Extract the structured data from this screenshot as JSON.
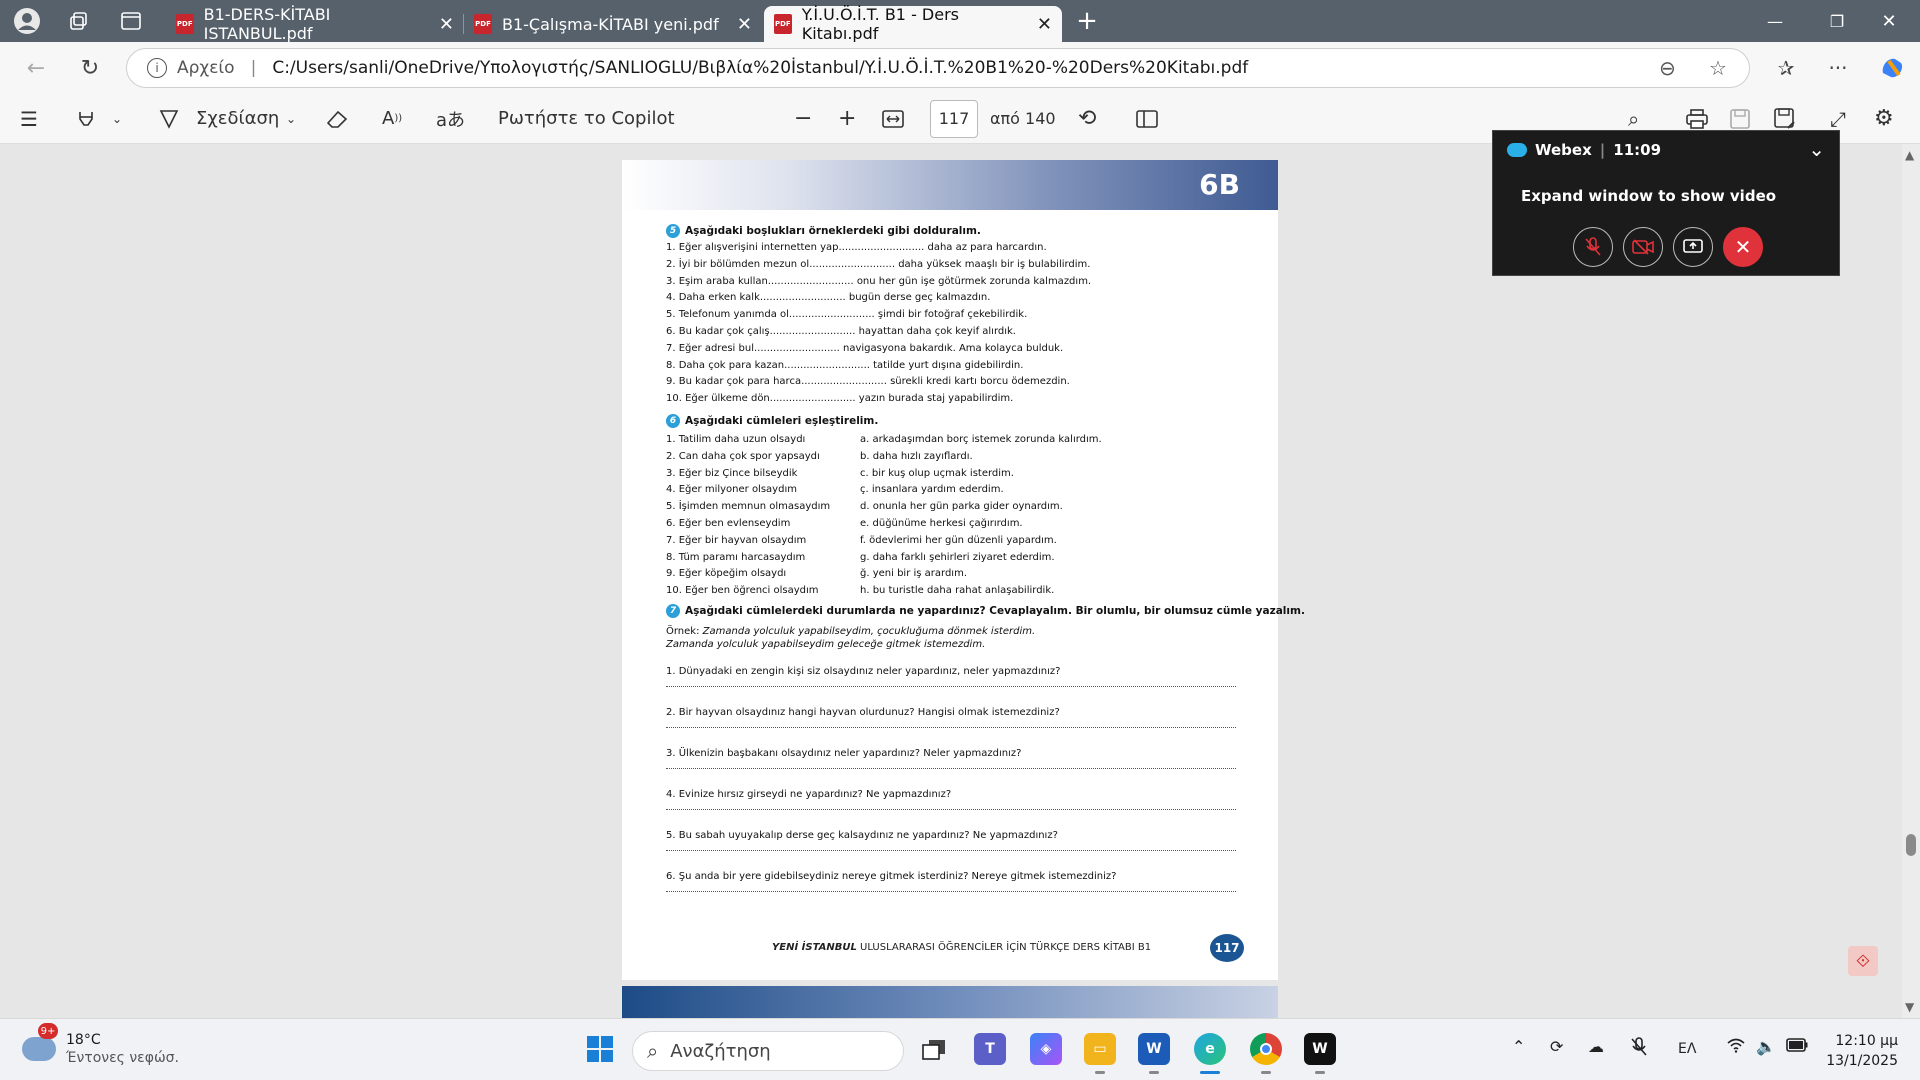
{
  "tabs": [
    {
      "label": "B1-DERS-KİTABI ISTANBUL.pdf",
      "active": false
    },
    {
      "label": "B1-Çalışma-KİTABI yeni.pdf",
      "active": false
    },
    {
      "label": "Y.İ.U.Ö.İ.T. B1 - Ders Kitabı.pdf",
      "active": true
    }
  ],
  "address": {
    "label": "Αρχείο",
    "url": "C:/Users/sanli/OneDrive/Υπολογιστής/SANLIOGLU/Βιβλία%20İstanbul/Y.İ.U.Ö.İ.T.%20B1%20-%20Ders%20Kitabı.pdf"
  },
  "pdf_toolbar": {
    "draw_label": "Σχεδίαση",
    "copilot_label": "Ρωτήστε το Copilot",
    "page_current": "117",
    "page_total": "από 140"
  },
  "document": {
    "unit_tag": "6B",
    "ex5": {
      "num": "5",
      "title": "Aşağıdaki boşlukları örneklerdeki gibi dolduralım.",
      "lines": [
        "1. Eğer alışverişini internetten yap...........................  daha az para harcardın.",
        "2. İyi bir bölümden mezun ol........................... daha yüksek maaşlı bir iş bulabilirdim.",
        "3. Eşim araba kullan........................... onu her gün işe götürmek zorunda kalmazdım.",
        "4. Daha erken kalk........................... bugün derse geç kalmazdın.",
        "5. Telefonum yanımda ol........................... şimdi bir fotoğraf çekebilirdik.",
        "6. Bu kadar çok çalış........................... hayattan daha çok keyif alırdık.",
        "7. Eğer adresi bul........................... navigasyona bakardık. Ama kolayca bulduk.",
        "8. Daha çok para kazan........................... tatilde yurt dışına gidebilirdin.",
        "9. Bu kadar çok para harca........................... sürekli kredi kartı borcu ödemezdin.",
        "10. Eğer ülkeme dön........................... yazın burada staj yapabilirdim."
      ]
    },
    "ex6": {
      "num": "6",
      "title": "Aşağıdaki cümleleri eşleştirelim.",
      "left": [
        "1. Tatilim daha uzun olsaydı",
        "2. Can daha çok spor yapsaydı",
        "3. Eğer biz Çince bilseydik",
        "4. Eğer milyoner olsaydım",
        "5. İşimden memnun olmasaydım",
        "6. Eğer ben evlenseydim",
        "7. Eğer bir hayvan olsaydım",
        "8. Tüm paramı harcasaydım",
        "9. Eğer köpeğim olsaydı",
        "10. Eğer ben öğrenci olsaydım"
      ],
      "right": [
        "a. arkadaşımdan borç istemek zorunda kalırdım.",
        "b. daha hızlı zayıflardı.",
        "c. bir kuş olup uçmak isterdim.",
        "ç. insanlara yardım ederdim.",
        "d. onunla her gün parka gider oynardım.",
        "e. düğünüme herkesi çağırırdım.",
        "f. ödevlerimi her gün düzenli yapardım.",
        "g. daha farklı şehirleri ziyaret ederdim.",
        "ğ. yeni bir iş arardım.",
        "h. bu turistle daha rahat anlaşabilirdik."
      ]
    },
    "ex7": {
      "num": "7",
      "title": "Aşağıdaki cümlelerdeki durumlarda ne yapardınız? Cevaplayalım. Bir olumlu, bir olumsuz cümle yazalım.",
      "example_label": "Örnek:",
      "example1": "Zamanda yolculuk yapabilseydim, çocukluğuma dönmek isterdim.",
      "example2": "Zamanda yolculuk yapabilseydim geleceğe gitmek istemezdim.",
      "questions": [
        "1. Dünyadaki en zengin kişi siz olsaydınız neler yapardınız, neler yapmazdınız?",
        "2. Bir hayvan olsaydınız hangi hayvan olurdunuz? Hangisi olmak istemezdiniz?",
        "3. Ülkenizin başbakanı olsaydınız neler yapardınız? Neler yapmazdınız?",
        "4. Evinize hırsız girseydi ne yapardınız? Ne yapmazdınız?",
        "5. Bu sabah uyuyakalıp derse geç kalsaydınız ne yapardınız? Ne yapmazdınız?",
        "6. Şu anda bir yere gidebilseydiniz nereye gitmek isterdiniz? Nereye gitmek istemezdiniz?"
      ]
    },
    "footer_bold": "YENİ İSTANBUL",
    "footer_rest": " ULUSLARARASI ÖĞRENCİLER İÇİN TÜRKÇE DERS KİTABI B1",
    "page_number": "117"
  },
  "webex": {
    "title": "Webex",
    "time": "11:09",
    "message": "Expand window to show video"
  },
  "taskbar": {
    "badge": "9+",
    "temp": "18°C",
    "weather": "Έντονες νεφώσ.",
    "search_placeholder": "Αναζήτηση",
    "lang": "ΕΛ",
    "time": "12:10 μμ",
    "date": "13/1/2025"
  }
}
